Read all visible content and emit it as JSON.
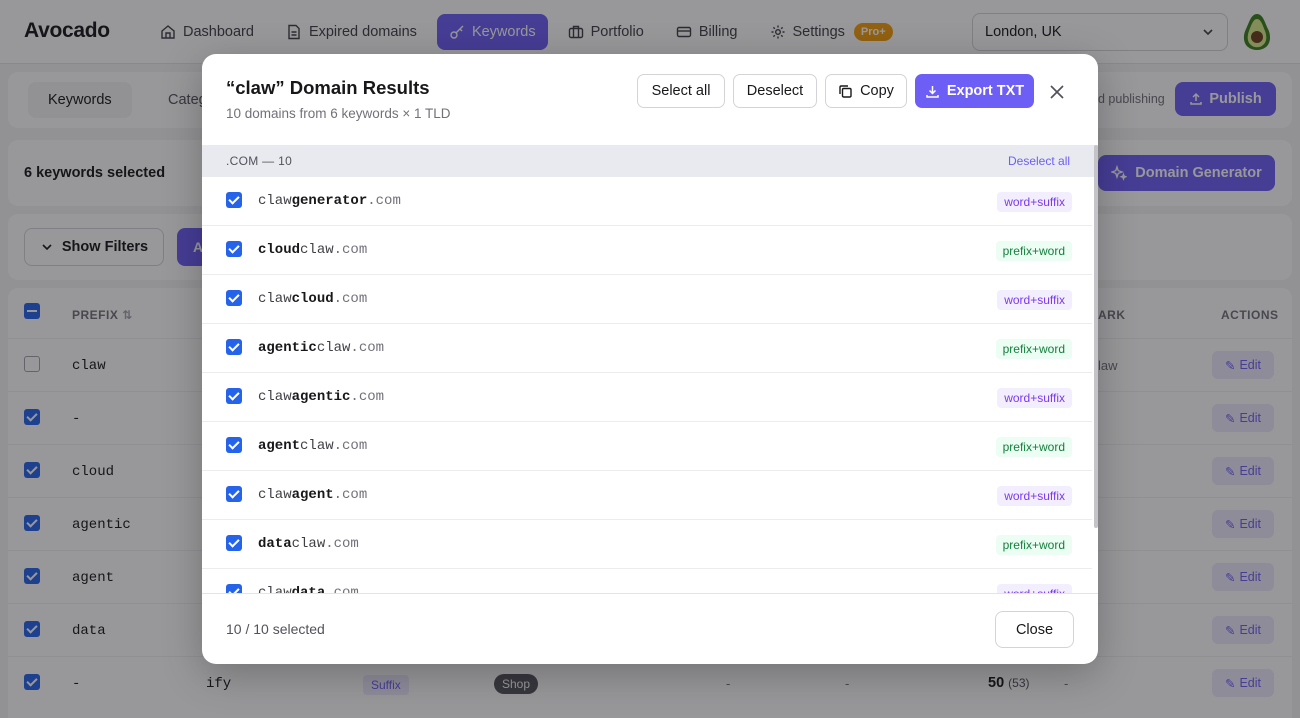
{
  "app": {
    "brand": "Avocado",
    "nav": [
      {
        "label": "Dashboard",
        "icon": "home-icon"
      },
      {
        "label": "Expired domains",
        "icon": "document-icon"
      },
      {
        "label": "Keywords",
        "icon": "key-icon",
        "active": true
      },
      {
        "label": "Portfolio",
        "icon": "briefcase-icon"
      },
      {
        "label": "Billing",
        "icon": "card-icon"
      },
      {
        "label": "Settings",
        "icon": "gear-icon",
        "badge": "Pro+"
      }
    ],
    "location": "London, UK"
  },
  "subbar": {
    "tabs": [
      "Keywords",
      "Categ"
    ],
    "auto_publish_text": "d publishing",
    "publish_label": "Publish"
  },
  "selection_bar": {
    "text": "6 keywords selected",
    "domain_generator_label": "Domain Generator"
  },
  "filters": {
    "show_filters_label": "Show Filters",
    "stub_label": "A"
  },
  "table": {
    "headers": {
      "prefix": "PREFIX",
      "mark": "ARK",
      "actions": "ACTIONS"
    },
    "edit_label": "Edit",
    "rows": [
      {
        "prefix": "claw",
        "checked": false,
        "mark": "law"
      },
      {
        "prefix": "-",
        "checked": true
      },
      {
        "prefix": "cloud",
        "checked": true
      },
      {
        "prefix": "agentic",
        "checked": true
      },
      {
        "prefix": "agent",
        "checked": true
      },
      {
        "prefix": "data",
        "checked": true
      },
      {
        "prefix": "-",
        "checked": true,
        "suffix": "ify",
        "type": "Suffix",
        "category": "Shop",
        "col_a": "-",
        "col_b": "-",
        "score": "50",
        "score_sub": "(53)",
        "col_c": "-"
      }
    ]
  },
  "modal": {
    "title": "“claw” Domain Results",
    "subtitle": "10 domains from 6 keywords × 1 TLD",
    "buttons": {
      "select_all": "Select all",
      "deselect": "Deselect",
      "copy": "Copy",
      "export": "Export TXT"
    },
    "group": {
      "label": ".COM — 10",
      "action": "Deselect all"
    },
    "domains": [
      {
        "pre": "claw",
        "bold": "generator",
        "post": "",
        "tld": ".com",
        "tag": "word+suffix",
        "kind": "ws"
      },
      {
        "pre": "",
        "bold": "cloud",
        "post": "claw",
        "tld": ".com",
        "tag": "prefix+word",
        "kind": "pw"
      },
      {
        "pre": "claw",
        "bold": "cloud",
        "post": "",
        "tld": ".com",
        "tag": "word+suffix",
        "kind": "ws"
      },
      {
        "pre": "",
        "bold": "agentic",
        "post": "claw",
        "tld": ".com",
        "tag": "prefix+word",
        "kind": "pw"
      },
      {
        "pre": "claw",
        "bold": "agentic",
        "post": "",
        "tld": ".com",
        "tag": "word+suffix",
        "kind": "ws"
      },
      {
        "pre": "",
        "bold": "agent",
        "post": "claw",
        "tld": ".com",
        "tag": "prefix+word",
        "kind": "pw"
      },
      {
        "pre": "claw",
        "bold": "agent",
        "post": "",
        "tld": ".com",
        "tag": "word+suffix",
        "kind": "ws"
      },
      {
        "pre": "",
        "bold": "data",
        "post": "claw",
        "tld": ".com",
        "tag": "prefix+word",
        "kind": "pw"
      },
      {
        "pre": "claw",
        "bold": "data",
        "post": "",
        "tld": ".com",
        "tag": "word+suffix",
        "kind": "ws"
      }
    ],
    "footer": {
      "count": "10 / 10 selected",
      "close_label": "Close"
    }
  },
  "colors": {
    "accent": "#6d5ef6",
    "checkbox": "#2563eb",
    "pro_badge": "#f59e0b"
  }
}
